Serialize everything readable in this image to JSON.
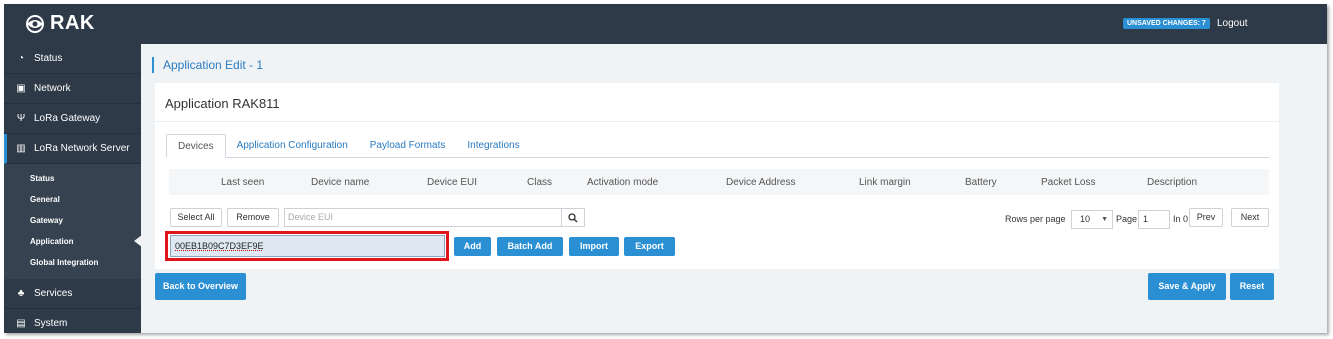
{
  "header": {
    "brand": "RAK",
    "unsaved_badge": "UNSAVED CHANGES: 7",
    "logout": "Logout"
  },
  "sidebar": {
    "items": [
      {
        "label": "Status",
        "icon": "dashboard-icon"
      },
      {
        "label": "Network",
        "icon": "network-icon"
      },
      {
        "label": "LoRa Gateway",
        "icon": "antenna-icon"
      },
      {
        "label": "LoRa Network Server",
        "icon": "bar-chart-icon"
      },
      {
        "label": "Services",
        "icon": "users-icon"
      },
      {
        "label": "System",
        "icon": "hard-drive-icon"
      }
    ],
    "submenu": [
      "Status",
      "General",
      "Gateway",
      "Application",
      "Global Integration"
    ]
  },
  "main": {
    "page_title": "Application Edit - 1",
    "card_title": "Application RAK811",
    "tabs": [
      "Devices",
      "Application Configuration",
      "Payload Formats",
      "Integrations"
    ],
    "columns": [
      "Last seen",
      "Device name",
      "Device EUI",
      "Class",
      "Activation mode",
      "Device Address",
      "Link margin",
      "Battery",
      "Packet Loss",
      "Description"
    ],
    "toolbar": {
      "select_all": "Select All",
      "remove": "Remove",
      "search_placeholder": "Device EUI",
      "search_icon": "search-icon"
    },
    "pager": {
      "rows_per_page_label": "Rows per page",
      "rows_per_page_value": "10",
      "page_label": "Page",
      "page_value": "1",
      "in_label": "In 0",
      "prev": "Prev",
      "next": "Next"
    },
    "add_row": {
      "eui_value": "00EB1B09C7D3EF9E",
      "add": "Add",
      "batch_add": "Batch Add",
      "import": "Import",
      "export": "Export"
    },
    "footer": {
      "back": "Back to Overview",
      "save_apply": "Save & Apply",
      "reset": "Reset"
    }
  },
  "colors": {
    "sidebar_bg": "#2e3a48",
    "accent": "#2b8fd4",
    "highlight": "#e0141b"
  }
}
